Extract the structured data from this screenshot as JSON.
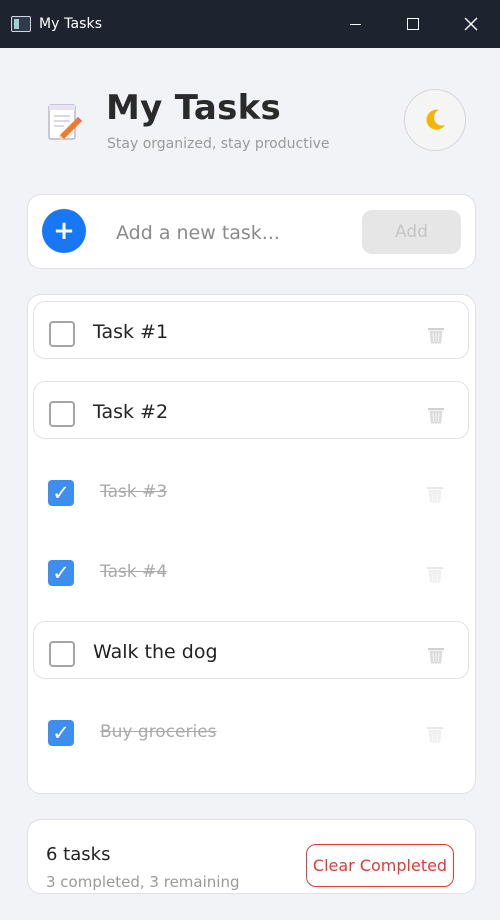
{
  "window": {
    "title": "My Tasks"
  },
  "header": {
    "title": "My Tasks",
    "subtitle": "Stay organized, stay productive"
  },
  "add_task": {
    "placeholder": "Add a new task...",
    "add_label": "Add"
  },
  "tasks": [
    {
      "label": "Task #1",
      "completed": false
    },
    {
      "label": "Task #2",
      "completed": false
    },
    {
      "label": "Task #3",
      "completed": true
    },
    {
      "label": "Task #4",
      "completed": true
    },
    {
      "label": "Walk the dog",
      "completed": false
    },
    {
      "label": "Buy groceries",
      "completed": true
    }
  ],
  "footer": {
    "count_text": "6 tasks",
    "stats_text": "3 completed, 3 remaining",
    "clear_label": "Clear Completed"
  },
  "colors": {
    "accent": "#1877f2",
    "checked": "#3d8ef0",
    "danger": "#e53935"
  }
}
